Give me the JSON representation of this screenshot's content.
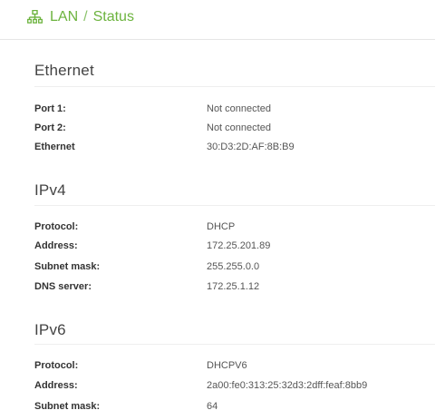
{
  "breadcrumb": {
    "icon": "network-icon",
    "section": "LAN",
    "separator": "/",
    "page": "Status"
  },
  "colors": {
    "accent": "#6cb33e"
  },
  "ethernet": {
    "title": "Ethernet",
    "rows": [
      {
        "label": "Port 1:",
        "value": "Not connected"
      },
      {
        "label": "Port 2:",
        "value": "Not connected"
      },
      {
        "label": "Ethernet",
        "value": "30:D3:2D:AF:8B:B9"
      }
    ]
  },
  "ipv4": {
    "title": "IPv4",
    "rows": [
      {
        "label": "Protocol:",
        "value": "DHCP"
      },
      {
        "label": "Address:",
        "value": "172.25.201.89"
      },
      {
        "label": "Subnet mask:",
        "value": "255.255.0.0"
      },
      {
        "label": "DNS server:",
        "value": "172.25.1.12"
      }
    ]
  },
  "ipv6": {
    "title": "IPv6",
    "rows": [
      {
        "label": "Protocol:",
        "value": "DHCPV6"
      },
      {
        "label": "Address:",
        "value": "2a00:fe0:313:25:32d3:2dff:feaf:8bb9"
      },
      {
        "label": "Subnet mask:",
        "value": "64"
      }
    ]
  }
}
